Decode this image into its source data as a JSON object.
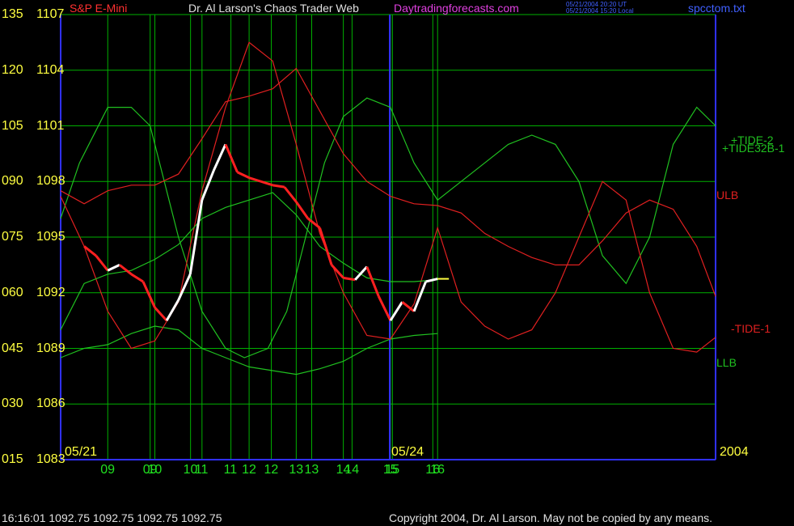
{
  "header": {
    "symbol": "S&P E-Mini",
    "title": "Dr. Al Larson's Chaos Trader Web",
    "site": "Daytradingforecasts.com",
    "time_ut": "05/21/2004 20:20 UT",
    "time_local": "05/21/2004 15:20 Local",
    "file": "spcctom.txt"
  },
  "footer": {
    "quote": "16:16:01  1092.75 1092.75 1092.75 1092.75",
    "copyright": "Copyright 2004, Dr. Al Larson. May not be copied by any means."
  },
  "colors": {
    "background": "#000000",
    "grid": "#00b000",
    "axis": "#3030ff",
    "price_up": "#ffffff",
    "price_down": "#ff2020",
    "envelope": "#e02020",
    "cycle": "#20c020",
    "yellow": "#ffff40"
  },
  "chart_data": {
    "type": "line",
    "y_left_labels": [
      "135",
      "120",
      "105",
      "090",
      "075",
      "060",
      "045",
      "030",
      "015"
    ],
    "y_price_labels": [
      "1107",
      "1104",
      "1101",
      "1098",
      "1095",
      "1092",
      "1089",
      "1086",
      "1083"
    ],
    "ylim": [
      1083,
      1107
    ],
    "date_labels": [
      "05/21",
      "05/24",
      "2004"
    ],
    "x_ticks": [
      "09",
      "10",
      "11",
      "12",
      "13",
      "14",
      "15",
      "16",
      "09",
      "10",
      "11",
      "12",
      "13",
      "14",
      "15",
      "16"
    ],
    "legend": [
      {
        "name": "+TIDE-2",
        "color": "#20c020"
      },
      {
        "name": "+TIDE32B-1",
        "color": "#20c020"
      },
      {
        "name": "ULB",
        "color": "#e02020"
      },
      {
        "name": "-TIDE-1",
        "color": "#e02020"
      },
      {
        "name": "LLB",
        "color": "#20c020"
      }
    ],
    "price": {
      "x": [
        8.5,
        8.75,
        9.0,
        9.25,
        9.5,
        9.75,
        10.0,
        10.25,
        10.5,
        10.75,
        11.0,
        11.25,
        11.5,
        11.75,
        12.0,
        12.25,
        12.5,
        12.75,
        13.0,
        13.25,
        13.5,
        13.75,
        14.0,
        14.25,
        14.5,
        14.75,
        15.0,
        15.25,
        15.5,
        15.75,
        16.0
      ],
      "y": [
        1094.5,
        1094.0,
        1093.2,
        1093.5,
        1093.0,
        1092.6,
        1091.2,
        1090.5,
        1091.6,
        1093.0,
        1097.0,
        1098.6,
        1100.0,
        1098.5,
        1098.2,
        1098.0,
        1097.8,
        1097.7,
        1096.9,
        1096.0,
        1095.5,
        1093.5,
        1092.8,
        1092.7,
        1093.4,
        1091.8,
        1090.5,
        1091.5,
        1091.0,
        1092.6,
        1092.75
      ],
      "last": 1092.75
    },
    "series": [
      {
        "name": "+TIDE32B-1",
        "x": [
          8.0,
          8.4,
          9.0,
          9.5,
          9.9,
          10.5,
          11.0,
          11.5,
          11.9,
          12.4,
          12.8,
          13.2,
          13.6,
          14.0,
          14.5,
          15.0,
          15.5,
          16.0,
          16.5,
          17.0,
          17.5,
          18.0,
          18.5,
          19.0,
          19.5,
          20.0,
          20.5,
          21.0,
          21.5,
          21.9
        ],
        "y": [
          1096.0,
          1099.0,
          1102.0,
          1102.0,
          1101.0,
          1095.0,
          1091.0,
          1089.0,
          1088.5,
          1089.0,
          1091.0,
          1095.0,
          1099.0,
          1101.5,
          1102.5,
          1102.0,
          1099.0,
          1097.0,
          1098.0,
          1099.0,
          1100.0,
          1100.5,
          1100.0,
          1098.0,
          1094.0,
          1092.5,
          1095.0,
          1100.0,
          1102.0,
          1101.0
        ]
      },
      {
        "name": "+TIDE-2",
        "x": [
          8.0,
          8.5,
          9.0,
          9.5,
          10.0,
          10.5,
          11.0,
          11.5,
          12.0,
          12.5,
          13.0,
          13.5,
          14.0,
          14.5,
          15.0,
          15.5,
          16.0
        ],
        "y": [
          1088.5,
          1089.0,
          1089.2,
          1089.8,
          1090.2,
          1090.0,
          1089.0,
          1088.5,
          1088.0,
          1087.8,
          1087.6,
          1087.9,
          1088.3,
          1089.0,
          1089.5,
          1089.7,
          1089.8
        ]
      },
      {
        "name": "ULB",
        "x": [
          8.0,
          8.5,
          9.0,
          9.5,
          10.0,
          10.5,
          11.0,
          11.5,
          12.0,
          12.5,
          13.0,
          13.5,
          14.0,
          14.5,
          15.0,
          15.5,
          16.0,
          16.5,
          17.0,
          17.5,
          18.0,
          18.5,
          19.0,
          19.5,
          20.0,
          20.5,
          21.0,
          21.5,
          21.9
        ],
        "y": [
          1097.5,
          1096.8,
          1097.5,
          1097.8,
          1097.8,
          1098.4,
          1100.3,
          1102.3,
          1102.6,
          1103.0,
          1104.1,
          1101.8,
          1099.5,
          1098.0,
          1097.2,
          1096.8,
          1096.7,
          1096.3,
          1095.2,
          1094.5,
          1093.9,
          1093.5,
          1093.5,
          1094.8,
          1096.3,
          1097.0,
          1096.5,
          1094.5,
          1091.8
        ]
      },
      {
        "name": "-TIDE-1",
        "x": [
          8.0,
          8.5,
          9.0,
          9.5,
          10.0,
          10.5,
          11.0,
          11.5,
          12.0,
          12.5,
          13.0,
          13.5,
          14.0,
          14.5,
          15.0,
          15.5,
          16.0,
          16.5,
          17.0,
          17.5,
          18.0,
          18.5,
          19.0,
          19.5,
          20.0,
          20.5,
          21.0,
          21.5,
          21.9
        ],
        "y": [
          1097.2,
          1094.5,
          1091.0,
          1089.0,
          1089.4,
          1091.5,
          1097.5,
          1102.0,
          1105.5,
          1104.5,
          1100.0,
          1095.2,
          1092.0,
          1089.7,
          1089.5,
          1091.4,
          1095.5,
          1091.5,
          1090.2,
          1089.5,
          1090.0,
          1092.0,
          1095.0,
          1098.0,
          1097.0,
          1092.0,
          1089.0,
          1088.8,
          1089.6
        ]
      },
      {
        "name": "LLB",
        "x": [
          8.0,
          8.5,
          9.0,
          9.5,
          10.0,
          10.5,
          11.0,
          11.5,
          12.0,
          12.5,
          13.0,
          13.5,
          14.0,
          14.5,
          15.0,
          15.5,
          16.0
        ],
        "y": [
          1090.0,
          1092.5,
          1093.0,
          1093.2,
          1093.8,
          1094.6,
          1096.0,
          1096.6,
          1097.0,
          1097.4,
          1096.2,
          1094.5,
          1093.6,
          1092.8,
          1092.6,
          1092.6,
          1092.7
        ]
      }
    ]
  }
}
